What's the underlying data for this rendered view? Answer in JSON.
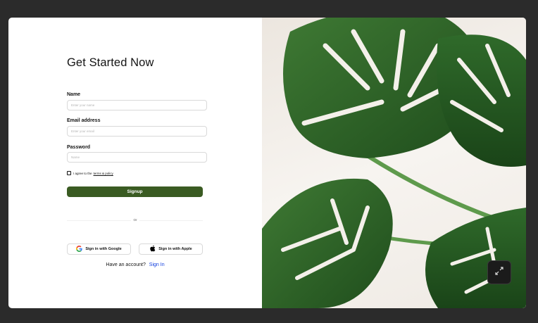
{
  "form": {
    "title": "Get Started Now",
    "name_label": "Name",
    "name_placeholder": "Enter your name",
    "email_label": "Email address",
    "email_placeholder": "Enter your email",
    "password_label": "Password",
    "password_placeholder": "Name",
    "agree_prefix": "I agree to the",
    "agree_link": "terms & policy",
    "signup_label": "Signup",
    "or_label": "Or",
    "google_label": "Sign in with Google",
    "apple_label": "Sign in with Apple",
    "account_text": "Have an account?",
    "signin_link": "Sign In"
  },
  "colors": {
    "primary": "#3a5b22",
    "link": "#0f3dde",
    "background": "#2b2b2b"
  },
  "icons": {
    "google": "google-icon",
    "apple": "apple-icon",
    "expand": "collapse-icon"
  }
}
